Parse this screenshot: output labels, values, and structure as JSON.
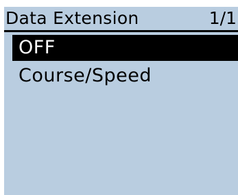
{
  "header": {
    "title": "Data Extension",
    "page_indicator": "1/1"
  },
  "menu": {
    "items": [
      {
        "label": "OFF",
        "selected": true
      },
      {
        "label": "Course/Speed",
        "selected": false
      }
    ]
  },
  "colors": {
    "screen_background": "#b9cde0",
    "text": "#000000",
    "selection_background": "#000000",
    "selection_text": "#ffffff"
  }
}
